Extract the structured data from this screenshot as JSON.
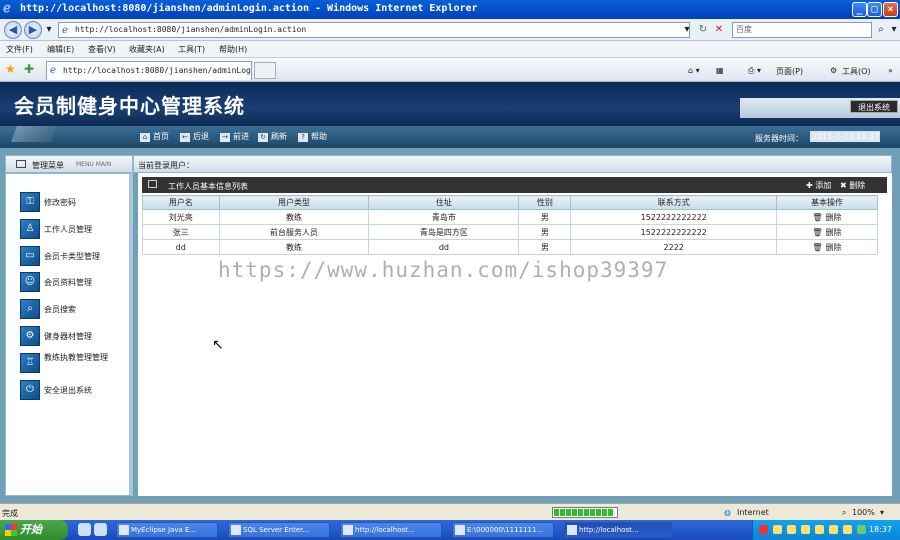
{
  "browser": {
    "window_title": "http://localhost:8080/jianshen/adminLogin.action - Windows Internet Explorer",
    "address": "http://localhost:8080/jianshen/adminLogin.action",
    "search_placeholder": "百度",
    "menu": [
      "文件(F)",
      "编辑(E)",
      "查看(V)",
      "收藏夹(A)",
      "工具(T)",
      "帮助(H)"
    ],
    "tab_title": "http://localhost:8080/jianshen/adminLogin...",
    "cmd_page": "页面(P)",
    "cmd_tools": "工具(O)",
    "status_text": "完成",
    "zone": "Internet",
    "zoom": "100%",
    "progress": 0.95
  },
  "app": {
    "title": "会员制健身中心管理系统",
    "logout": "退出系统",
    "nav": [
      {
        "label": "首页",
        "icon": "home-icon"
      },
      {
        "label": "后退",
        "icon": "back-arrow-icon"
      },
      {
        "label": "前进",
        "icon": "forward-arrow-icon"
      },
      {
        "label": "刷新",
        "icon": "refresh-icon"
      },
      {
        "label": "帮助",
        "icon": "help-icon"
      }
    ],
    "server_time_label": "服务器时间：",
    "server_time": "2011-2-23 18:37"
  },
  "sidebar": {
    "header": "管理菜单",
    "header_sub": "MENU MAIN",
    "items": [
      "修改密码",
      "工作人员管理",
      "会员卡类型管理",
      "会员资料管理",
      "会员搜索",
      "健身器材管理",
      "教练执教管理管理",
      "安全退出系统"
    ]
  },
  "main": {
    "login_label": "当前登录用户：",
    "table_title": "工作人员基本信息列表",
    "add_label": "添加",
    "delete_label": "删除",
    "columns": [
      "用户名",
      "用户类型",
      "住址",
      "性别",
      "联系方式",
      "基本操作"
    ],
    "rows": [
      [
        "刘光亮",
        "教练",
        "青岛市",
        "男",
        "1522222222222",
        "删除"
      ],
      [
        "张三",
        "前台服务人员",
        "青岛是四方区",
        "男",
        "1522222222222",
        "删除"
      ],
      [
        "dd",
        "教练",
        "dd",
        "男",
        "2222",
        "删除"
      ]
    ]
  },
  "watermark": "https://www.huzhan.com/ishop39397",
  "taskbar": {
    "start": "开始",
    "tasks": [
      "MyEclipse Java E...",
      "SQL Server Enter...",
      "http://localhost...",
      "E:\\000000\\1111111...",
      "http://localhost..."
    ],
    "clock": "18:37"
  }
}
